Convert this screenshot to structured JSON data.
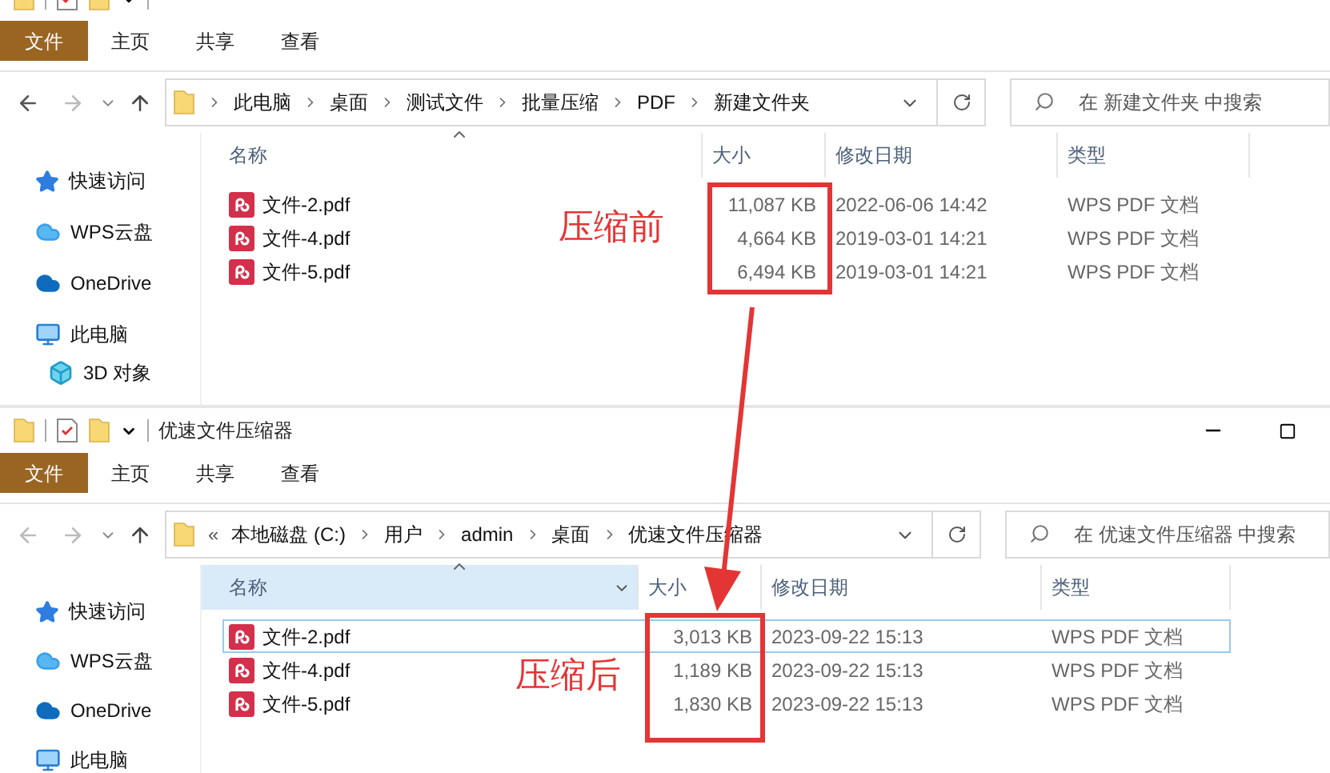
{
  "windows": [
    {
      "show_controls": false,
      "ribbon_tabs": [
        {
          "label": "文件",
          "selected": true
        },
        {
          "label": "主页",
          "selected": false
        },
        {
          "label": "共享",
          "selected": false
        },
        {
          "label": "查看",
          "selected": false
        }
      ],
      "path": [
        "此电脑",
        "桌面",
        "测试文件",
        "批量压缩",
        "PDF",
        "新建文件夹"
      ],
      "search": {
        "placeholder": "在 新建文件夹 中搜索"
      },
      "nav": [
        {
          "label": "快速访问",
          "kind": "star"
        },
        {
          "label": "WPS云盘",
          "kind": "cloud"
        },
        {
          "label": "OneDrive",
          "kind": "onedrive"
        },
        {
          "label": "此电脑",
          "kind": "pc"
        },
        {
          "label": "3D 对象",
          "kind": "cube"
        }
      ],
      "columns": [
        {
          "label": "名称",
          "hovered": false
        },
        {
          "label": "大小",
          "hovered": false
        },
        {
          "label": "修改日期",
          "hovered": false
        },
        {
          "label": "类型",
          "hovered": false
        }
      ],
      "files": [
        {
          "name": "文件-2.pdf",
          "size": "11,087 KB",
          "modified": "2022-06-06 14:42",
          "type": "WPS PDF 文档",
          "selected": false
        },
        {
          "name": "文件-4.pdf",
          "size": "4,664 KB",
          "modified": "2019-03-01 14:21",
          "type": "WPS PDF 文档",
          "selected": false
        },
        {
          "name": "文件-5.pdf",
          "size": "6,494 KB",
          "modified": "2019-03-01 14:21",
          "type": "WPS PDF 文档",
          "selected": false
        }
      ],
      "annotation": "压缩前"
    },
    {
      "title": "优速文件压缩器",
      "show_controls": true,
      "ribbon_tabs": [
        {
          "label": "文件",
          "selected": true
        },
        {
          "label": "主页",
          "selected": false
        },
        {
          "label": "共享",
          "selected": false
        },
        {
          "label": "查看",
          "selected": false
        }
      ],
      "path_overflow": "«",
      "path": [
        "本地磁盘 (C:)",
        "用户",
        "admin",
        "桌面",
        "优速文件压缩器"
      ],
      "search": {
        "placeholder": "在 优速文件压缩器 中搜索"
      },
      "nav": [
        {
          "label": "快速访问",
          "kind": "star"
        },
        {
          "label": "WPS云盘",
          "kind": "cloud"
        },
        {
          "label": "OneDrive",
          "kind": "onedrive"
        },
        {
          "label": "此电脑",
          "kind": "pc"
        }
      ],
      "columns": [
        {
          "label": "名称",
          "hovered": true
        },
        {
          "label": "大小",
          "hovered": false
        },
        {
          "label": "修改日期",
          "hovered": false
        },
        {
          "label": "类型",
          "hovered": false
        }
      ],
      "files": [
        {
          "name": "文件-2.pdf",
          "size": "3,013 KB",
          "modified": "2023-09-22 15:13",
          "type": "WPS PDF 文档",
          "selected": true
        },
        {
          "name": "文件-4.pdf",
          "size": "1,189 KB",
          "modified": "2023-09-22 15:13",
          "type": "WPS PDF 文档",
          "selected": false
        },
        {
          "name": "文件-5.pdf",
          "size": "1,830 KB",
          "modified": "2023-09-22 15:13",
          "type": "WPS PDF 文档",
          "selected": false
        }
      ],
      "annotation": "压缩后"
    }
  ]
}
